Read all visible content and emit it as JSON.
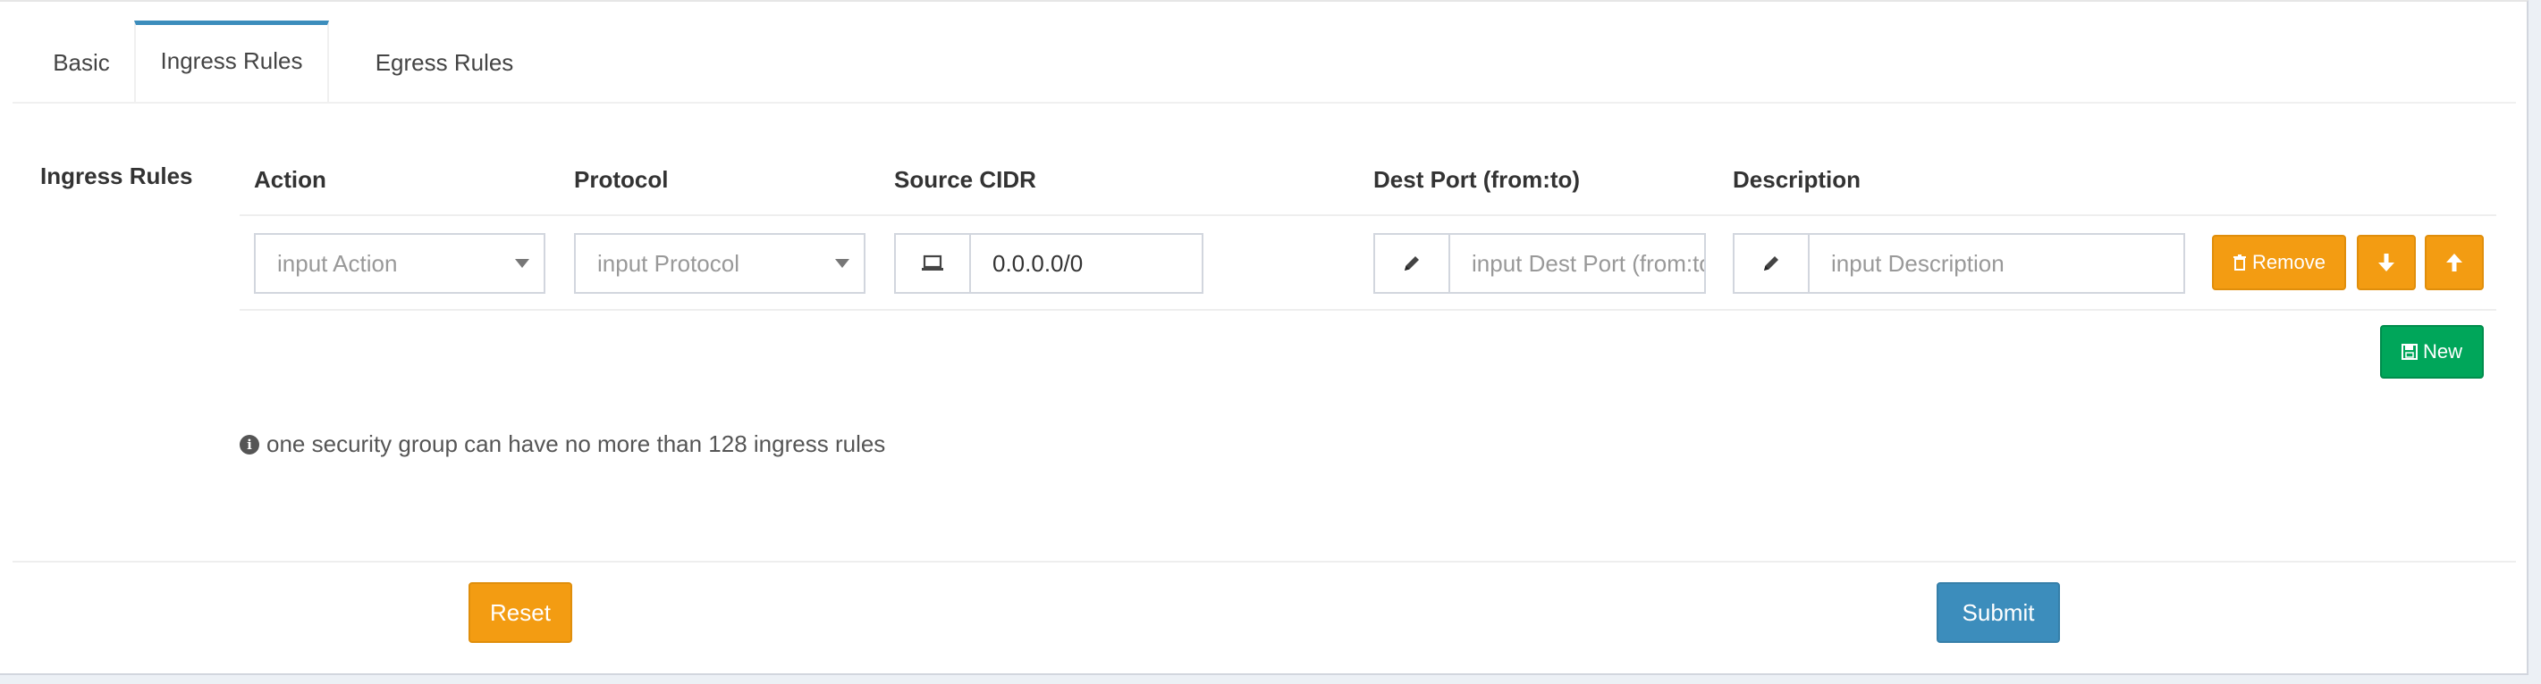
{
  "tabs": [
    {
      "label": "Basic"
    },
    {
      "label": "Ingress Rules"
    },
    {
      "label": "Egress Rules"
    }
  ],
  "active_tab": "Ingress Rules",
  "section_label": "Ingress Rules",
  "columns": {
    "action": "Action",
    "protocol": "Protocol",
    "source_cidr": "Source CIDR",
    "dest_port": "Dest Port (from:to)",
    "description": "Description"
  },
  "row": {
    "action_placeholder": "input Action",
    "protocol_placeholder": "input Protocol",
    "source_cidr_value": "0.0.0.0/0",
    "dest_port_placeholder": "input Dest Port (from:to)",
    "description_placeholder": "input Description"
  },
  "buttons": {
    "remove": "Remove",
    "new": "New",
    "reset": "Reset",
    "submit": "Submit"
  },
  "help_text": "one security group can have no more than 128 ingress rules",
  "icons": {
    "source": "laptop-icon",
    "dest_port": "pencil-icon",
    "description": "pencil-icon",
    "remove": "trash-icon",
    "move_down": "arrow-down-icon",
    "move_up": "arrow-up-icon",
    "new": "save-icon",
    "help": "info-circle-icon"
  },
  "colors": {
    "primary": "#3c8dbc",
    "warning": "#f39c12",
    "success": "#00a65a"
  }
}
